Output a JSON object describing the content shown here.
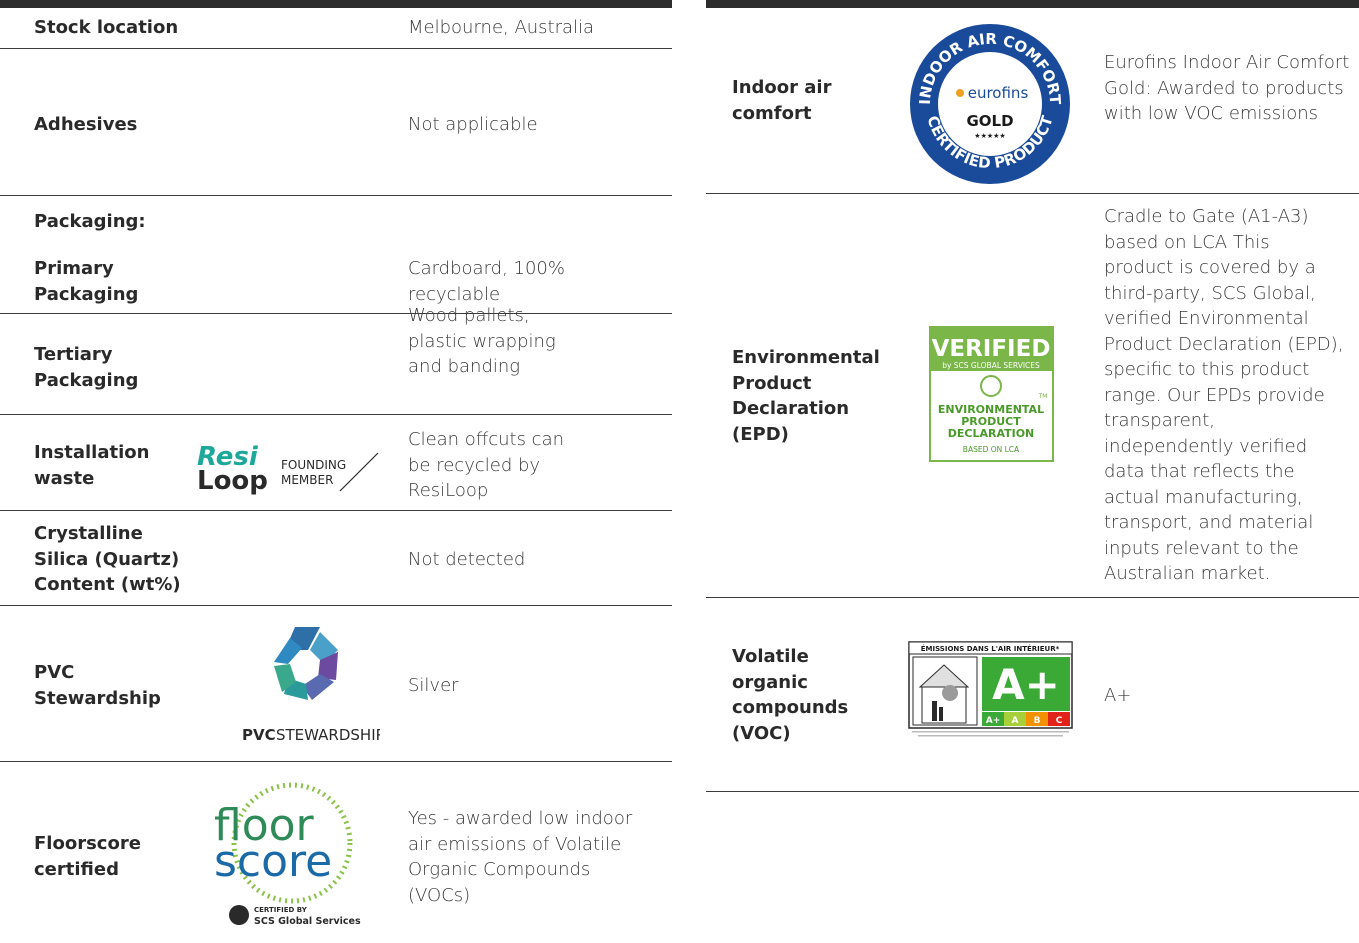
{
  "left_rows": {
    "stock_location": {
      "label": "Stock location",
      "value": "Melbourne, Australia"
    },
    "adhesives": {
      "label": "Adhesives",
      "value": "Not applicable"
    },
    "packaging_heading": "Packaging:",
    "primary_packaging": {
      "label": "Primary Packaging",
      "value": "Cardboard, 100% recyclable"
    },
    "tertiary_packaging": {
      "label": "Tertiary Packaging",
      "value": "Wood pallets, plastic wrapping and banding"
    },
    "installation_waste": {
      "label": "Installation waste",
      "value": "Clean offcuts can be recycled by ResiLoop",
      "logo": {
        "line1": "Resi",
        "line2": "Loop",
        "sub1": "FOUNDING",
        "sub2": "MEMBER"
      }
    },
    "crystalline_silica": {
      "label": "Crystalline Silica (Quartz) Content (wt%)",
      "value": "Not detected"
    },
    "pvc_stewardship": {
      "label": "PVC Stewardship",
      "value": "Silver",
      "logo": {
        "bold": "PVC",
        "rest": "STEWARDSHIP"
      }
    },
    "floorscore": {
      "label": "Floorscore certified",
      "value": "Yes - awarded low indoor air emissions of Volatile Organic Compounds (VOCs)",
      "logo": {
        "line1": "floor",
        "line2": "score",
        "cert1": "CERTIFIED BY",
        "cert2": "SCS Global Services"
      }
    }
  },
  "right_rows": {
    "indoor_air": {
      "label": "Indoor air comfort",
      "value": "Eurofins Indoor Air Comfort Gold: Awarded to products with low VOC emissions",
      "logo": {
        "top_arc": "INDOOR AIR COMFORT",
        "bottom_arc": "CERTIFIED PRODUCT",
        "brand": "eurofins",
        "level": "GOLD",
        "stars": "★★★★★"
      }
    },
    "epd": {
      "label": "Environmental Product Declaration (EPD)",
      "value": "Cradle to Gate (A1-A3) based on LCA This product is covered by a third-party, SCS Global, verified Environmental Product Declaration (EPD), specific to this product range. Our EPDs provide transparent, independently verified data that reflects the actual manufacturing, transport, and material inputs relevant to the Australian market.",
      "logo": {
        "title": "VERIFIED",
        "by": "by SCS GLOBAL SERVICES",
        "tm": "TM",
        "l1": "ENVIRONMENTAL",
        "l2": "PRODUCT",
        "l3": "DECLARATION",
        "l4": "BASED ON LCA"
      }
    },
    "voc": {
      "label": "Volatile organic compounds (VOC)",
      "value": "A+",
      "logo": {
        "header": "ÉMISSIONS DANS L'AIR INTÉRIEUR*",
        "grade": "A+",
        "scale": [
          "A+",
          "A",
          "B",
          "C"
        ]
      }
    }
  },
  "colors": {
    "bar": "#2d2d2d",
    "eurofins_blue": "#1a4a9a",
    "scs_green": "#7ab648",
    "voc_green": "#3aa935",
    "resiloop_teal": "#1ea89a"
  }
}
